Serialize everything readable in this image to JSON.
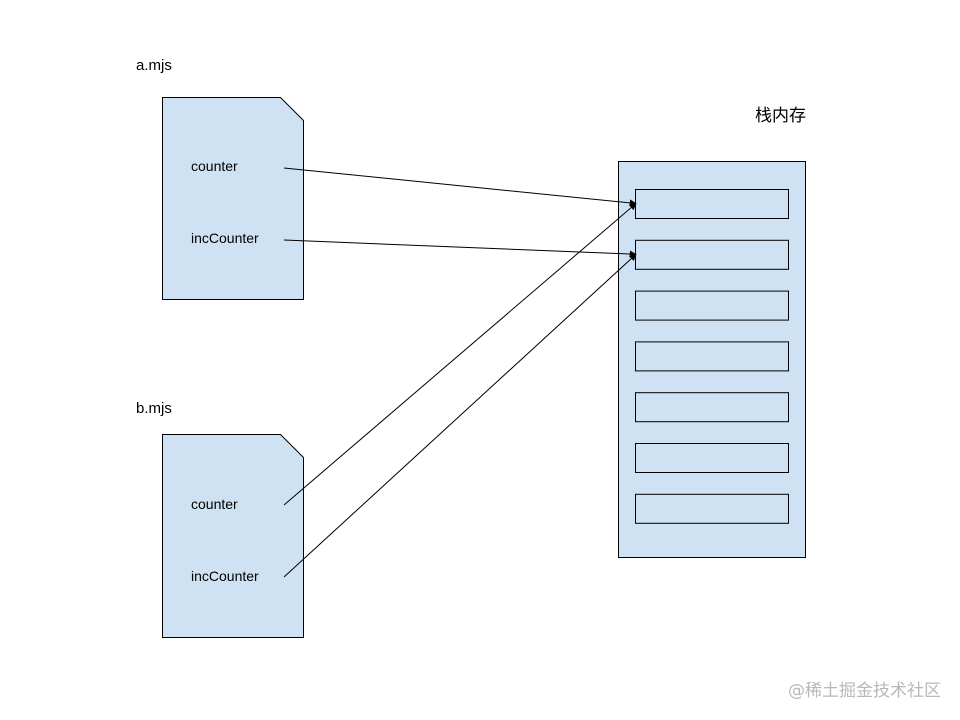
{
  "modules": [
    {
      "name": "a.mjs",
      "exports": [
        "counter",
        "incCounter"
      ]
    },
    {
      "name": "b.mjs",
      "exports": [
        "counter",
        "incCounter"
      ]
    }
  ],
  "memory": {
    "title": "栈内存",
    "slot_count": 7
  },
  "references": [
    {
      "from_module": 0,
      "from_export": 0,
      "to_slot": 0
    },
    {
      "from_module": 0,
      "from_export": 1,
      "to_slot": 1
    },
    {
      "from_module": 1,
      "from_export": 0,
      "to_slot": 0
    },
    {
      "from_module": 1,
      "from_export": 1,
      "to_slot": 1
    }
  ],
  "colors": {
    "fill": "#cfe2f3",
    "stroke": "#000000"
  },
  "watermark": "@稀土掘金技术社区"
}
